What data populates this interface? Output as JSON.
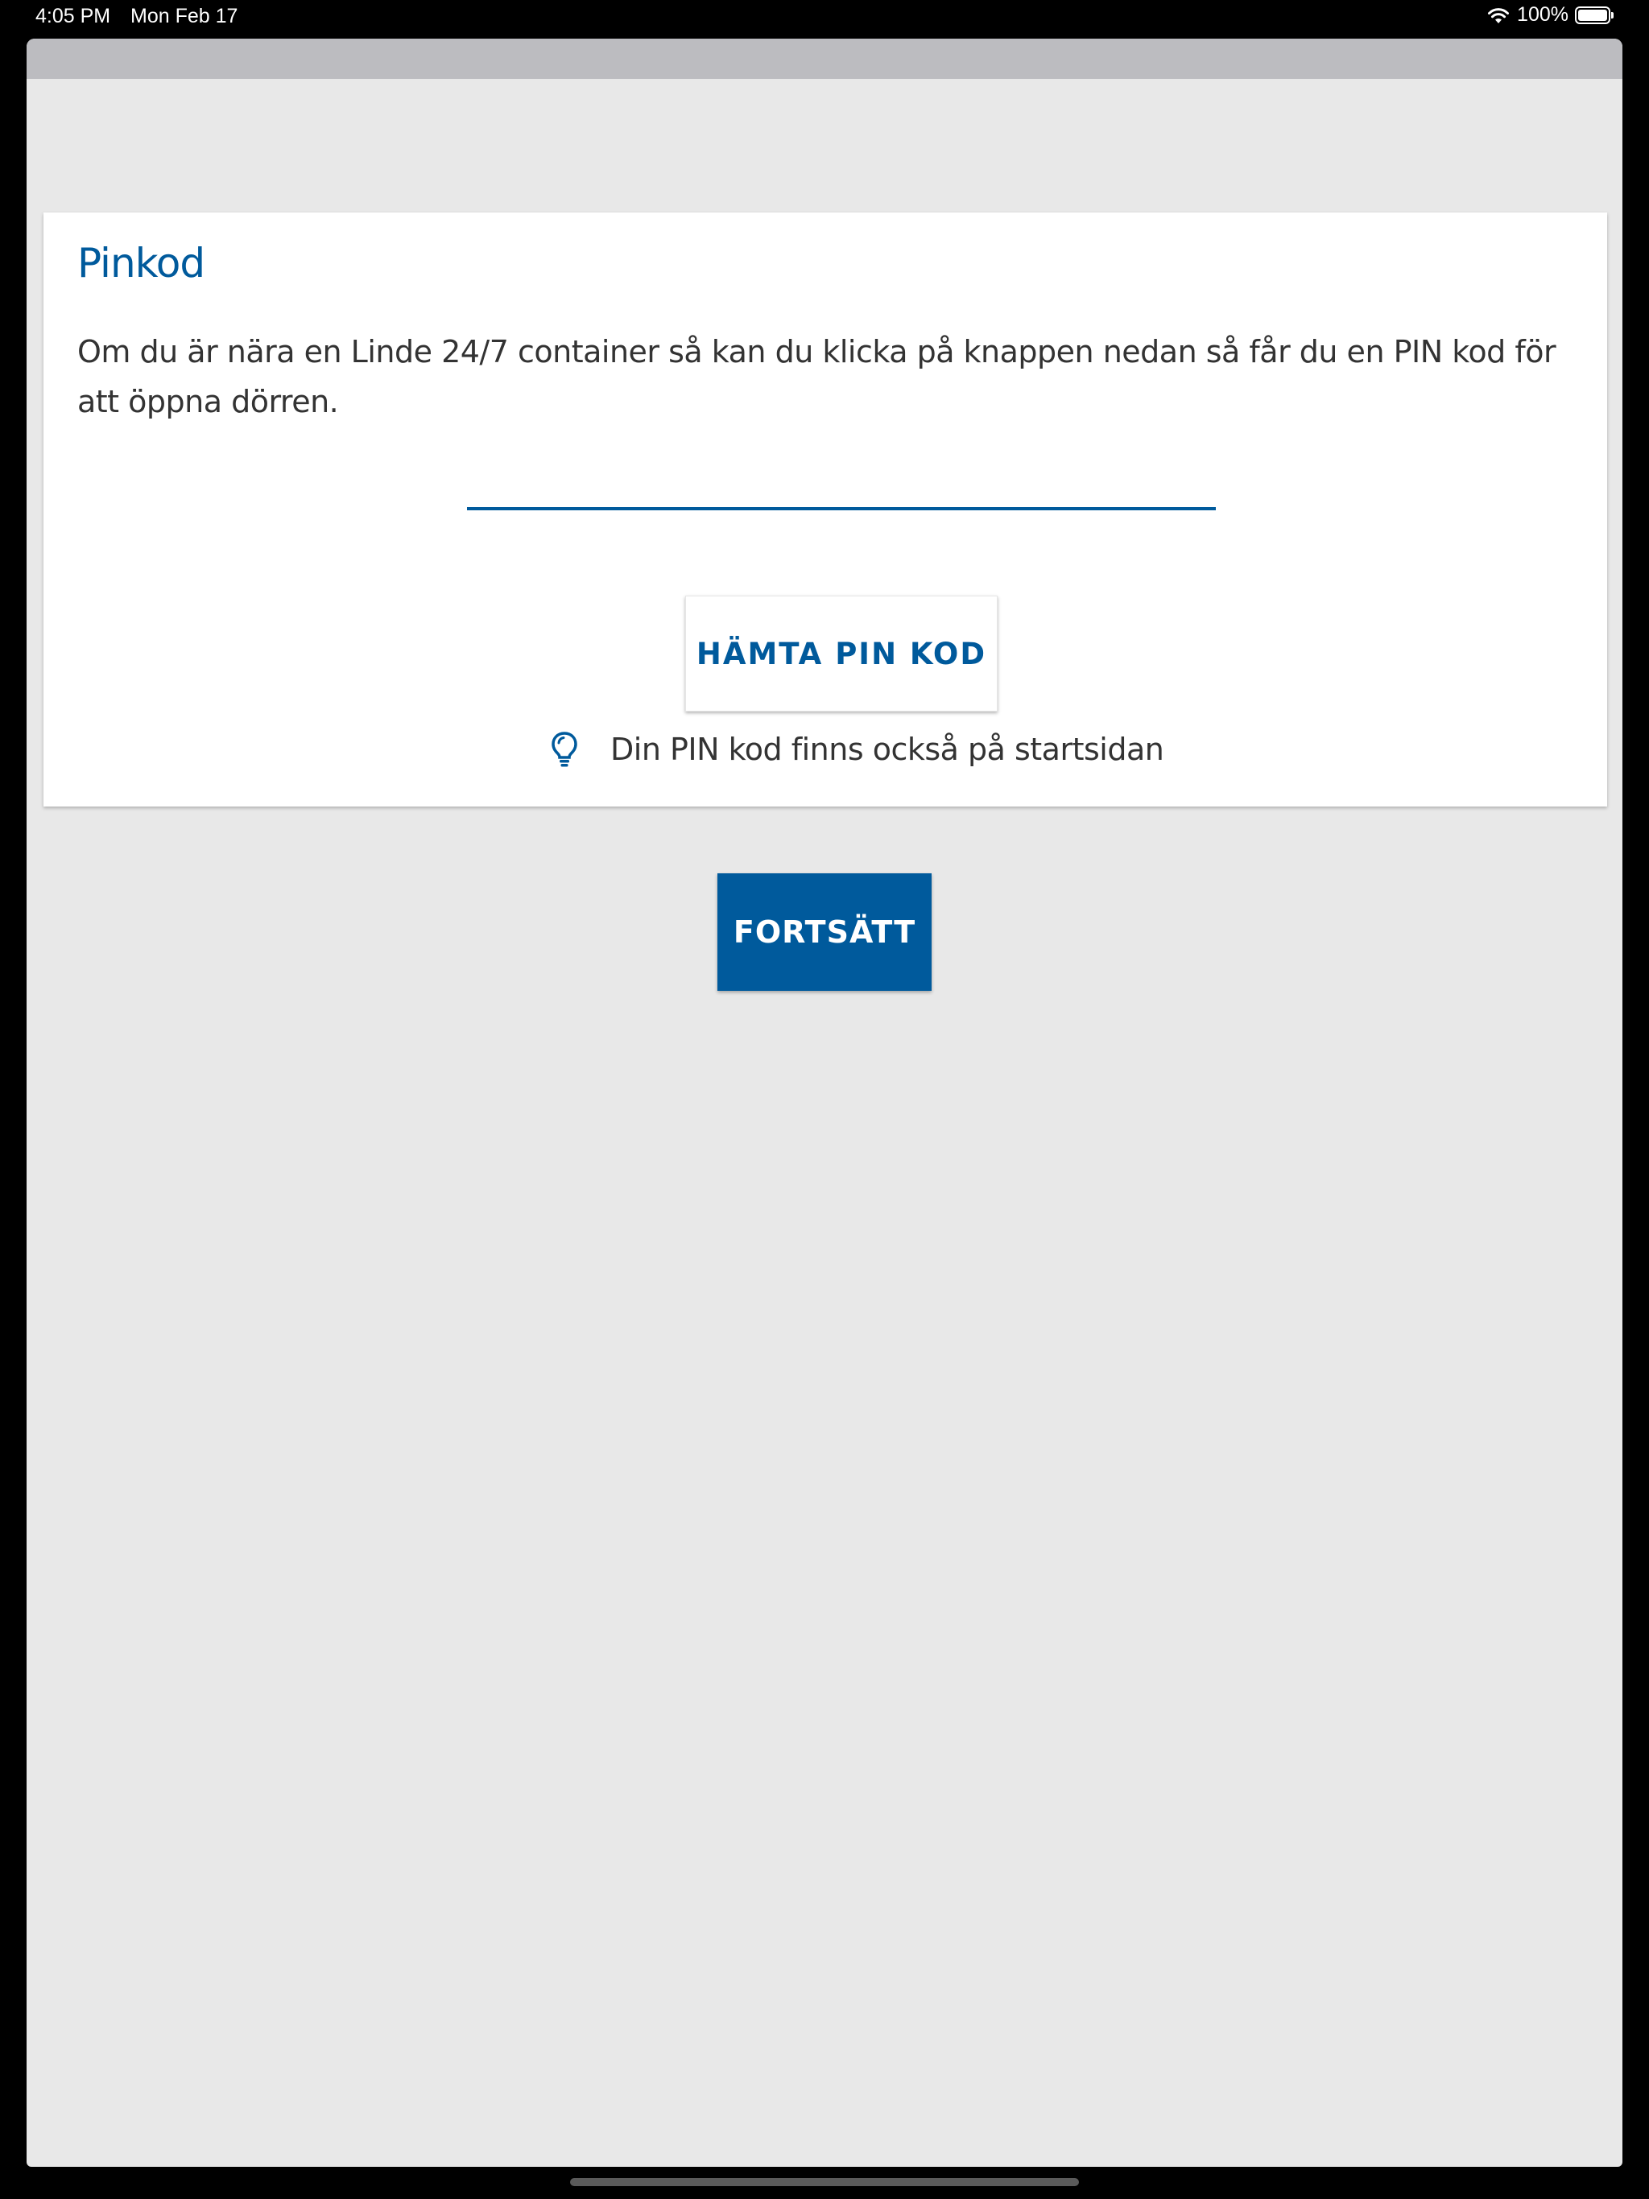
{
  "status_bar": {
    "time": "4:05 PM",
    "date": "Mon Feb 17",
    "battery": "100%",
    "wifi_icon": "wifi-icon",
    "battery_icon": "battery-icon"
  },
  "card": {
    "title": "Pinkod",
    "description": "Om du är nära en Linde 24/7 container så kan du klicka på knappen nedan så får du en PIN kod för att öppna dörren.",
    "pin_input": {
      "value": "",
      "placeholder": ""
    },
    "fetch_button_label": "HÄMTA PIN KOD",
    "hint_icon": "lightbulb-icon",
    "hint_text": "Din PIN kod finns också på startsidan"
  },
  "continue_button_label": "FORTSÄTT",
  "colors": {
    "brand_blue": "#005a9c",
    "background": "#e8e8e8",
    "card": "#ffffff",
    "text": "#333333"
  }
}
